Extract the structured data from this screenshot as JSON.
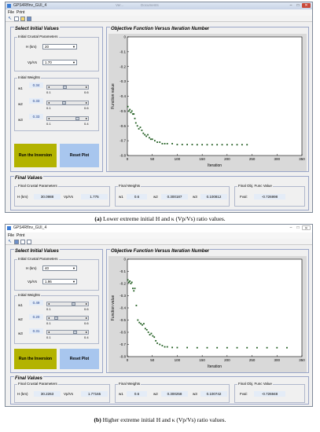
{
  "window_a": {
    "title": "GPS4RfInv_GUI_4",
    "taskbar_tabs": [
      "Ver...",
      "Documents"
    ],
    "menu": [
      "File",
      "Print"
    ],
    "panels": {
      "initial": "Select Initial Values",
      "objective": "Objective Function Versus Iteration Number",
      "final": "Final Values"
    },
    "crustal_title": "Initial Crustal Parameters",
    "h_label": "H (km)",
    "h_value": "20",
    "vpvs_label": "Vp/Vs",
    "vpvs_value": "1.70",
    "weights_title": "Initial Weights",
    "w1_label": "w1",
    "w1_value": "0.34",
    "w1_min": "0.1",
    "w1_max": "0.6",
    "w2_label": "w2",
    "w2_value": "0.33",
    "w2_min": "0.1",
    "w2_max": "0.6",
    "w3_label": "w3",
    "w3_value": "0.33",
    "w3_min": "0.1",
    "w3_max": "0.4",
    "run_button": "Run the Inversion",
    "reset_button": "Reset Plot",
    "final_crustal_title": "Final Crustal Parameters",
    "final_weights_title": "Final Weights",
    "final_obj_title": "Final Obj. Func Value",
    "f_h_label": "H (km)",
    "f_h_value": "30.0988",
    "f_vpvs_label": "Vp/Vs",
    "f_vpvs_value": "1.775",
    "f_w1_label": "w1",
    "f_w1_value": "0.6",
    "f_w2_label": "w2",
    "f_w2_value": "0.300187",
    "f_w3_label": "w3",
    "f_w3_value": "0.100812",
    "fval_label": "Fval:",
    "fval_value": "-0.726998",
    "window_ctrl": {
      "min": "–",
      "max": "□",
      "close": "✕"
    },
    "icons": {
      "tb_new": "new-file-icon",
      "tb_open": "open-folder-icon",
      "tb_save": "save-icon",
      "tb_copy": "copy-icon"
    }
  },
  "window_b": {
    "title": "GPS4RfInv_GUI_4",
    "menu": [
      "File",
      "Print"
    ],
    "panels": {
      "initial": "Select Initial Values",
      "objective": "Objective Function Versus Iteration Number",
      "final": "Final Values"
    },
    "crustal_title": "Initial Crustal Parameters",
    "h_label": "H (km)",
    "h_value": "40",
    "vpvs_label": "Vp/Vs",
    "vpvs_value": "1.96",
    "weights_title": "Initial Weights",
    "w1_label": "w1",
    "w1_value": "0.49",
    "w1_min": "0.1",
    "w1_max": "0.6",
    "w2_label": "w2",
    "w2_value": "0.20",
    "w2_min": "0.1",
    "w2_max": "0.6",
    "w3_label": "w3",
    "w3_value": "0.31",
    "w3_min": "0.1",
    "w3_max": "0.4",
    "run_button": "Run the Inversion",
    "reset_button": "Reset Plot",
    "final_crustal_title": "Final Crustal Parameters",
    "final_weights_title": "Final Weights",
    "final_obj_title": "Final Obj. Func Value",
    "f_h_label": "H (km)",
    "f_h_value": "30.2263",
    "f_vpvs_label": "Vp/Vs",
    "f_vpvs_value": "1.77165",
    "f_w1_label": "w1",
    "f_w1_value": "0.6",
    "f_w2_label": "w2",
    "f_w2_value": "0.300258",
    "f_w3_label": "w3",
    "f_w3_value": "0.100742",
    "fval_label": "Fval:",
    "fval_value": "-0.726948",
    "window_ctrl": {
      "min": "–",
      "max": "□",
      "close": "✕"
    }
  },
  "captions": {
    "a_tag": "(a)",
    "a_text": " Lower extreme initial H and κ (Vp/Vs) ratio values.",
    "b_tag": "(b)",
    "b_text": " Higher extreme initial H and κ (Vp/Vs) ratio values."
  },
  "colors": {
    "run_button": "#b3b300",
    "reset_button": "#a8c6ee",
    "markers": "#1e5c1e",
    "plot_bg": "#ffffff",
    "panel_bg": "#f0f0f0"
  },
  "chart_data": [
    {
      "type": "scatter",
      "title": "",
      "xlabel": "Iteration",
      "ylabel": "Function value",
      "xlim": [
        0,
        350
      ],
      "ylim": [
        -0.8,
        0
      ],
      "xticks": [
        0,
        50,
        100,
        150,
        200,
        250,
        300,
        350
      ],
      "yticks": [
        0,
        -0.1,
        -0.2,
        -0.3,
        -0.4,
        -0.5,
        -0.6,
        -0.7,
        -0.8
      ],
      "grid": false,
      "series": [
        {
          "x": [
            1,
            3,
            5,
            7,
            9,
            11,
            13,
            15,
            17,
            20,
            23,
            26,
            29,
            32,
            35,
            38,
            41,
            44,
            47,
            50,
            55,
            60,
            65,
            70,
            75,
            80,
            90,
            100,
            110,
            120,
            130,
            140,
            150,
            160,
            170,
            180,
            190,
            200,
            210,
            220,
            230,
            240
          ],
          "y": [
            -0.47,
            -0.5,
            -0.49,
            -0.51,
            -0.5,
            -0.52,
            -0.52,
            -0.55,
            -0.58,
            -0.6,
            -0.62,
            -0.61,
            -0.63,
            -0.65,
            -0.66,
            -0.67,
            -0.66,
            -0.68,
            -0.69,
            -0.69,
            -0.7,
            -0.71,
            -0.71,
            -0.72,
            -0.72,
            -0.72,
            -0.72,
            -0.726,
            -0.726,
            -0.726,
            -0.726,
            -0.727,
            -0.727,
            -0.727,
            -0.727,
            -0.727,
            -0.727,
            -0.727,
            -0.727,
            -0.727,
            -0.727,
            -0.727
          ]
        }
      ]
    },
    {
      "type": "scatter",
      "title": "",
      "xlabel": "Iteration",
      "ylabel": "Function value",
      "xlim": [
        0,
        350
      ],
      "ylim": [
        -0.8,
        0
      ],
      "xticks": [
        0,
        50,
        100,
        150,
        200,
        250,
        300,
        350
      ],
      "yticks": [
        0,
        -0.1,
        -0.2,
        -0.3,
        -0.4,
        -0.5,
        -0.6,
        -0.7,
        -0.8
      ],
      "grid": false,
      "series": [
        {
          "x": [
            1,
            3,
            5,
            7,
            9,
            11,
            13,
            15,
            18,
            21,
            24,
            27,
            30,
            33,
            36,
            39,
            42,
            45,
            48,
            51,
            54,
            57,
            60,
            65,
            70,
            75,
            80,
            90,
            100,
            120,
            140,
            160,
            180,
            200,
            220,
            240,
            260,
            280,
            300,
            320
          ],
          "y": [
            -0.17,
            -0.19,
            -0.18,
            -0.2,
            -0.19,
            -0.24,
            -0.26,
            -0.24,
            -0.38,
            -0.5,
            -0.52,
            -0.53,
            -0.54,
            -0.53,
            -0.57,
            -0.58,
            -0.6,
            -0.62,
            -0.61,
            -0.63,
            -0.64,
            -0.67,
            -0.69,
            -0.7,
            -0.71,
            -0.72,
            -0.72,
            -0.725,
            -0.726,
            -0.726,
            -0.727,
            -0.727,
            -0.727,
            -0.727,
            -0.727,
            -0.727,
            -0.727,
            -0.727,
            -0.727,
            -0.727
          ]
        }
      ]
    }
  ]
}
